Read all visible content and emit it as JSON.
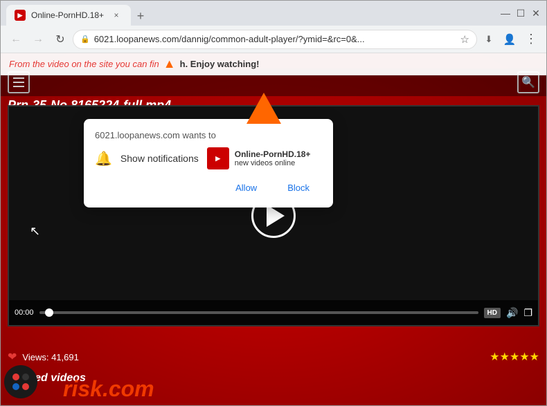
{
  "browser": {
    "tab": {
      "favicon_label": "▶",
      "title": "Online-PornHD.18+",
      "close_label": "×"
    },
    "new_tab_label": "+",
    "window_controls": {
      "minimize": "—",
      "maximize": "☐",
      "close": "✕"
    },
    "address_bar": {
      "lock_icon": "🔒",
      "url": "6021.loopanews.com/dannig/common-adult-player/?ymid=&rc=0&...",
      "bookmark_icon": "☆",
      "account_icon": "👤",
      "menu_icon": "⋮"
    },
    "download_icon": "⬇"
  },
  "info_bar": {
    "text_italic": "From the video on the site you can fin",
    "text_bold_suffix": "h. Enjoy watching!",
    "full_text": "From the video on the site you can finish. Enjoy watching!"
  },
  "page": {
    "site_name": "Online-PornHD.18+",
    "site_subtitle": "new videos online",
    "video_title": "Prn-35-No.8165224-full.mp4",
    "time": "00:00",
    "hd_badge": "HD",
    "views_label": "Views:",
    "views_count": "41,691",
    "stars": "★★★★★",
    "related_label": "Related videos",
    "site_logo": "risk.com"
  },
  "notification_popup": {
    "site_domain": "6021.loopanews.com wants to",
    "bell_label": "Show notifications",
    "site_icon_label": "▶",
    "site_name": "Online-PornHD.18+",
    "site_sub": "new videos online",
    "allow_button": "Allow",
    "block_button": "Block"
  }
}
